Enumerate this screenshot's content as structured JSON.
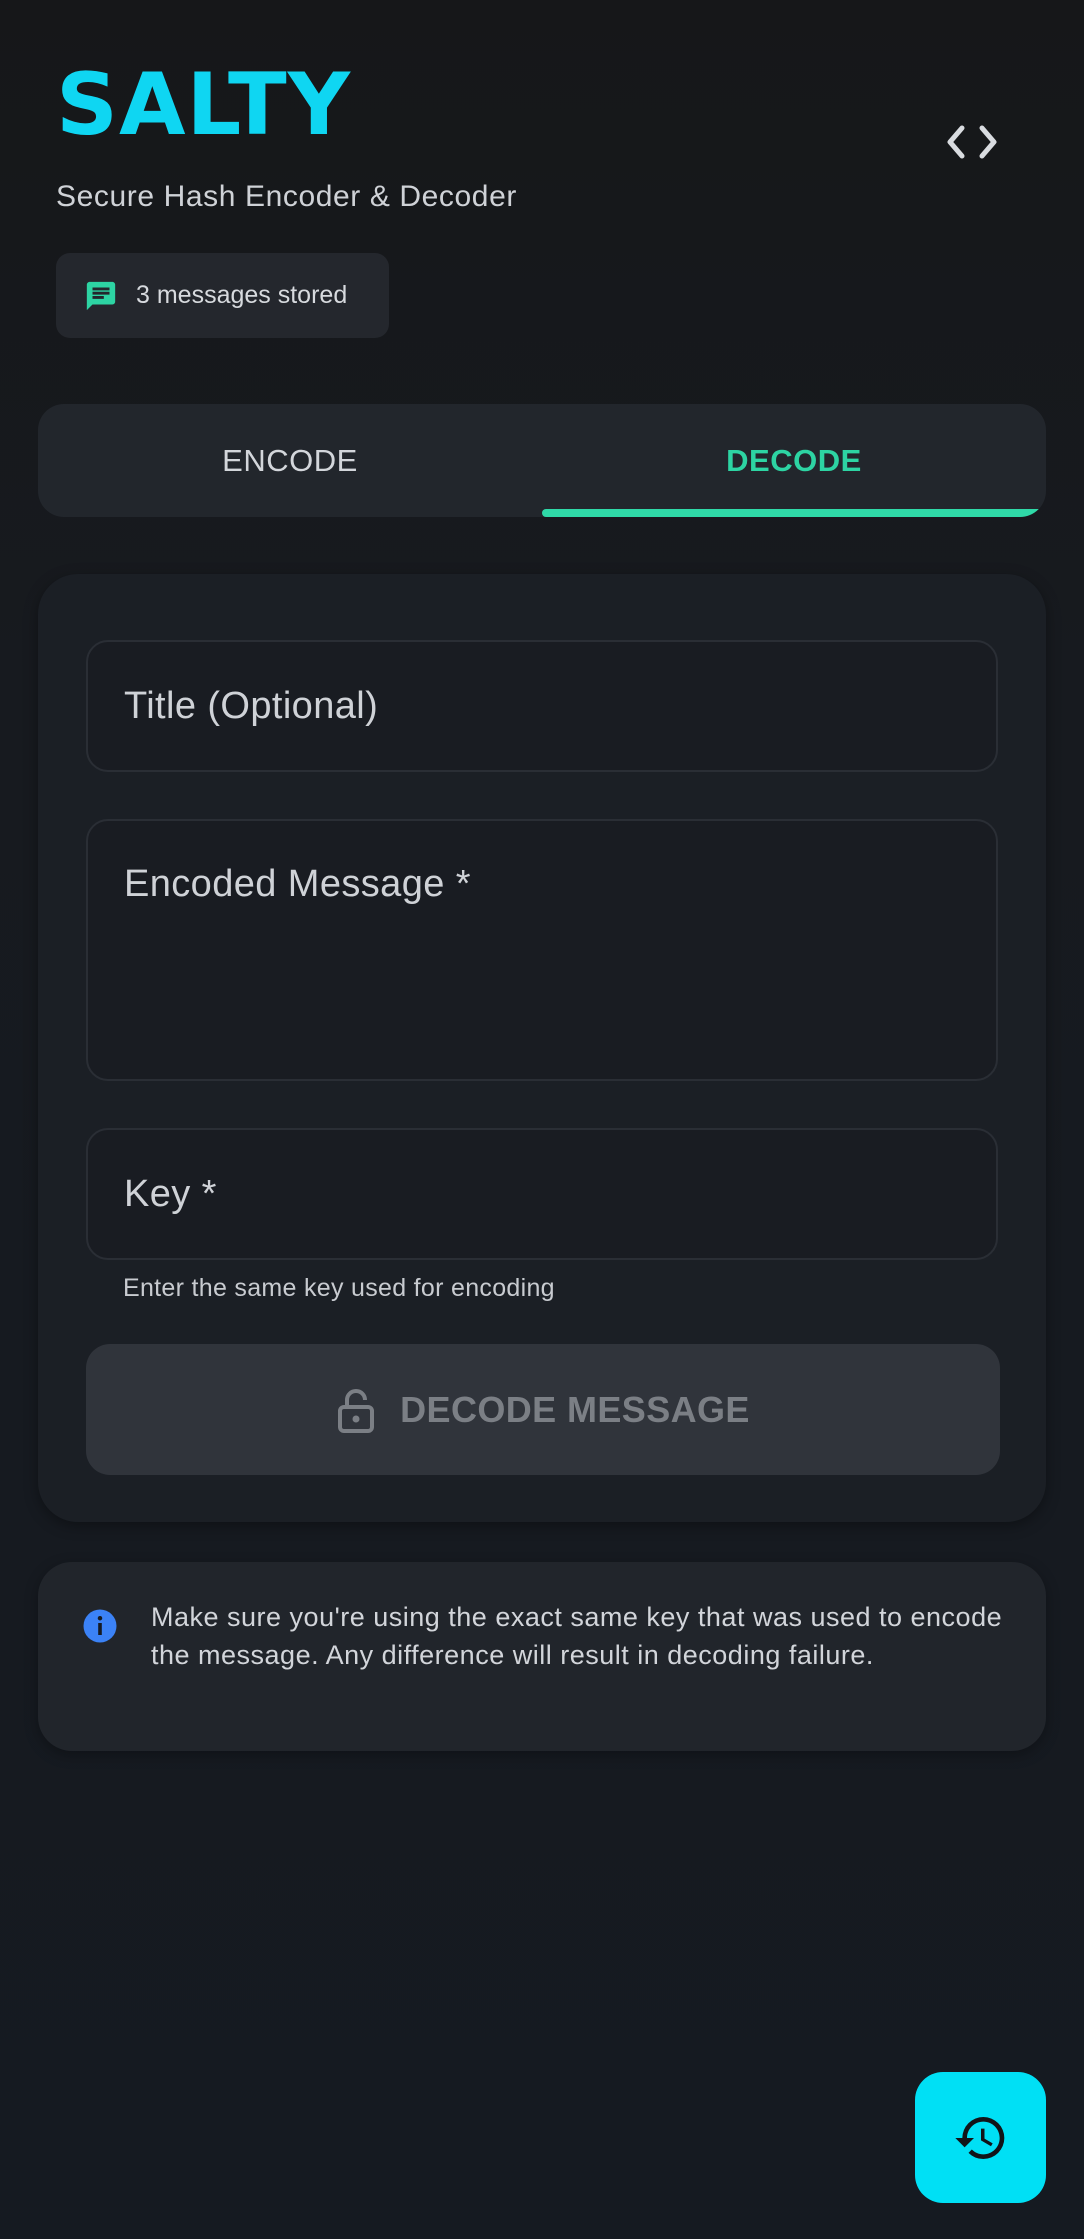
{
  "header": {
    "title": "SALTY",
    "subtitle": "Secure Hash Encoder & Decoder",
    "code_icon": "code-brackets-icon",
    "stored_chip": {
      "icon": "message-icon",
      "text": "3 messages stored"
    }
  },
  "tabs": [
    {
      "label": "ENCODE",
      "active": false
    },
    {
      "label": "DECODE",
      "active": true
    }
  ],
  "form": {
    "title_field": {
      "placeholder": "Title (Optional)",
      "value": ""
    },
    "message_field": {
      "placeholder": "Encoded Message *",
      "value": ""
    },
    "key_field": {
      "placeholder": "Key *",
      "value": "",
      "helper": "Enter the same key used for encoding"
    },
    "submit": {
      "label": "DECODE MESSAGE",
      "icon": "unlock-icon",
      "enabled": false
    }
  },
  "info": {
    "icon": "info-icon",
    "text": "Make sure you're using the exact same key that was used to encode the message. Any difference will result in decoding failure."
  },
  "fab": {
    "icon": "history-icon"
  },
  "colors": {
    "brand": "#0fd6f2",
    "accent": "#2dd4a3",
    "info": "#3b82f6",
    "fab": "#00e0f5"
  }
}
